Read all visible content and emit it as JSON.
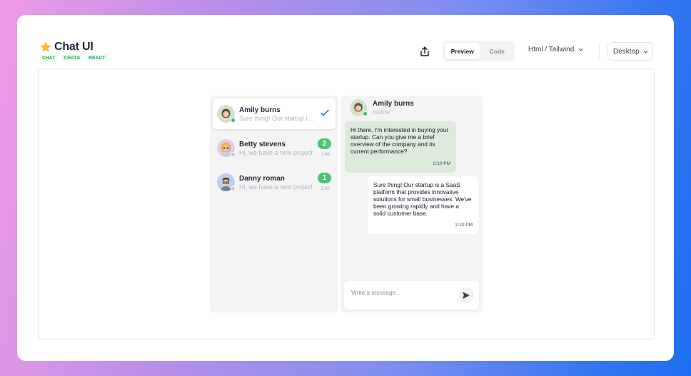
{
  "header": {
    "title": "Chat UI",
    "tags": [
      "CHAT",
      "CHATS",
      "REACT"
    ],
    "view_toggle": [
      {
        "label": "Preview",
        "active": true
      },
      {
        "label": "Code",
        "active": false
      }
    ],
    "framework_select": "Html / Tailwind",
    "device_select": "Desktop"
  },
  "chats": [
    {
      "name": "Amily burns",
      "preview": "Sure thing! Our startup is a SaaS platform",
      "status": "online",
      "read": true,
      "badge": "",
      "time": ""
    },
    {
      "name": "Betty stevens",
      "preview": "Hi, we have a new project",
      "status": "offline",
      "read": false,
      "badge": "2",
      "time": "1:48"
    },
    {
      "name": "Danny roman",
      "preview": "Hi, we have a new project",
      "status": "offline",
      "read": false,
      "badge": "1",
      "time": "2:30"
    }
  ],
  "conversation": {
    "name": "Amily burns",
    "status": "online",
    "messages": [
      {
        "direction": "in",
        "text": "Hi there, I'm interested in buying your startup. Can you give me a brief overview of the company and its current performance?",
        "time": "2:10 PM"
      },
      {
        "direction": "out",
        "text": "Sure thing! Our startup is a SaaS platform that provides innovative solutions for small businesses. We've been growing rapidly and have a solid customer base.",
        "time": "2:10 PM"
      }
    ],
    "composer_placeholder": "Write a message..."
  },
  "colors": {
    "accent_green": "#4cc474",
    "incoming_bubble": "#dcebdc",
    "check_blue": "#2563eb"
  },
  "icons": [
    "star-icon",
    "share-icon",
    "chevron-down-icon",
    "check-icon",
    "send-icon"
  ]
}
